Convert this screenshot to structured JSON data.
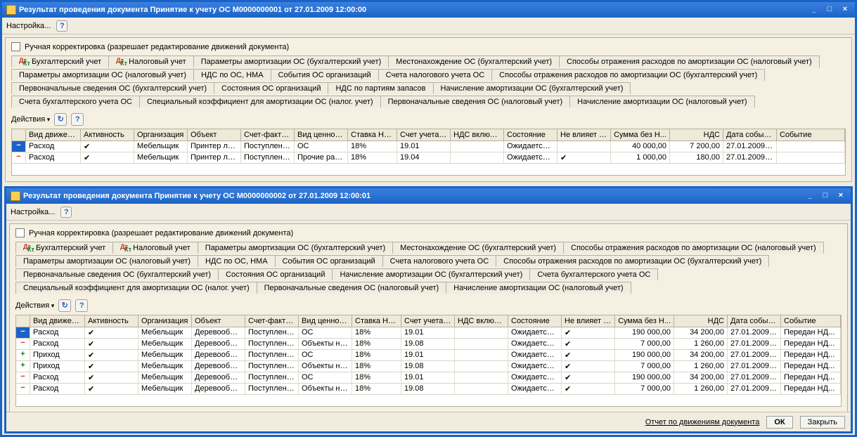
{
  "win1": {
    "title": "Результат проведения документа Принятие к учету ОС М0000000001 от 27.01.2009 12:00:00",
    "settings": "Настройка...",
    "manual_edit": "Ручная корректировка (разрешает редактирование движений документа)",
    "tabs_r1": [
      "Бухгалтерский учет",
      "Налоговый учет",
      "Параметры амортизации ОС (бухгалтерский учет)",
      "Местонахождение ОС (бухгалтерский учет)",
      "Способы отражения расходов по амортизации ОС (налоговый учет)"
    ],
    "tabs_r2": [
      "Параметры амортизации ОС (налоговый учет)",
      "НДС по ОС, НМА",
      "События ОС организаций",
      "Счета налогового учета ОС",
      "Способы отражения расходов по амортизации ОС (бухгалтерский учет)"
    ],
    "tabs_r3": [
      "Первоначальные сведения ОС (бухгалтерский учет)",
      "Состояния ОС организаций",
      "НДС по партиям запасов",
      "Начисление амортизации ОС (бухгалтерский учет)"
    ],
    "tabs_r4": [
      "Счета бухгалтерского учета ОС",
      "Специальный коэффициент для амортизации ОС (налог. учет)",
      "Первоначальные сведения ОС (налоговый учет)",
      "Начисление амортизации ОС (налоговый учет)"
    ],
    "actions": "Действия",
    "cols": [
      "",
      "Вид движения",
      "Активность",
      "Организация",
      "Объект",
      "Счет-фактура",
      "Вид ценности",
      "Ставка НДС",
      "Счет учета Н...",
      "НДС включе...",
      "Состояние",
      "Не влияет н...",
      "Сумма без Н...",
      "НДС",
      "Дата события",
      "Событие"
    ],
    "rows": [
      {
        "sign": "−",
        "move": "Расход",
        "act": "✔",
        "org": "Мебельщик",
        "obj": "Принтер лаз...",
        "inv": "Поступлени...",
        "val": "ОС",
        "vat": "18%",
        "acc": "19.01",
        "vinc": "",
        "state": "Ожидается ...",
        "noaff": "",
        "sum": "40 000,00",
        "nds": "7 200,00",
        "date": "27.01.2009 1...",
        "evt": ""
      },
      {
        "sign": "−",
        "move": "Расход",
        "act": "✔",
        "org": "Мебельщик",
        "obj": "Принтер лаз...",
        "inv": "Поступлени...",
        "val": "Прочие рабо...",
        "vat": "18%",
        "acc": "19.04",
        "vinc": "",
        "state": "Ожидается ...",
        "noaff": "✔",
        "sum": "1 000,00",
        "nds": "180,00",
        "date": "27.01.2009 1...",
        "evt": ""
      }
    ]
  },
  "win2": {
    "title": "Результат проведения документа Принятие к учету ОС М0000000002 от 27.01.2009 12:00:01",
    "settings": "Настройка...",
    "manual_edit": "Ручная корректировка (разрешает редактирование движений документа)",
    "tabs_r1": [
      "Бухгалтерский учет",
      "Налоговый учет",
      "Параметры амортизации ОС (бухгалтерский учет)",
      "Местонахождение ОС (бухгалтерский учет)",
      "Способы отражения расходов по амортизации ОС (налоговый учет)"
    ],
    "tabs_r2": [
      "Параметры амортизации ОС (налоговый учет)",
      "НДС по ОС, НМА",
      "События ОС организаций",
      "Счета налогового учета ОС",
      "Способы отражения расходов по амортизации ОС (бухгалтерский учет)"
    ],
    "tabs_r3": [
      "Первоначальные сведения ОС (бухгалтерский учет)",
      "Состояния ОС организаций",
      "Начисление амортизации ОС (бухгалтерский учет)",
      "Счета бухгалтерского учета ОС"
    ],
    "tabs_r4": [
      "Специальный коэффициент для амортизации ОС (налог. учет)",
      "Первоначальные сведения ОС (налоговый учет)",
      "Начисление амортизации ОС (налоговый учет)"
    ],
    "actions": "Действия",
    "cols": [
      "",
      "Вид движения",
      "Активность",
      "Организация",
      "Объект",
      "Счет-фактура",
      "Вид ценности",
      "Ставка НДС",
      "Счет учета Н...",
      "НДС включе...",
      "Состояние",
      "Не влияет н...",
      "Сумма без Н...",
      "НДС",
      "Дата события",
      "Событие"
    ],
    "rows": [
      {
        "sign": "−",
        "move": "Расход",
        "act": "✔",
        "org": "Мебельщик",
        "obj": "Деревообра...",
        "inv": "Поступлени...",
        "val": "ОС",
        "vat": "18%",
        "acc": "19.01",
        "vinc": "",
        "state": "Ожидается ...",
        "noaff": "✔",
        "sum": "190 000,00",
        "nds": "34 200,00",
        "date": "27.01.2009 1...",
        "evt": "Передан НД..."
      },
      {
        "sign": "−",
        "move": "Расход",
        "act": "✔",
        "org": "Мебельщик",
        "obj": "Деревообра...",
        "inv": "Поступлени...",
        "val": "Объекты не...",
        "vat": "18%",
        "acc": "19.08",
        "vinc": "",
        "state": "Ожидается ...",
        "noaff": "✔",
        "sum": "7 000,00",
        "nds": "1 260,00",
        "date": "27.01.2009 1...",
        "evt": "Передан НД..."
      },
      {
        "sign": "+",
        "move": "Приход",
        "act": "✔",
        "org": "Мебельщик",
        "obj": "Деревообра...",
        "inv": "Поступлени...",
        "val": "ОС",
        "vat": "18%",
        "acc": "19.01",
        "vinc": "",
        "state": "Ожидается ...",
        "noaff": "✔",
        "sum": "190 000,00",
        "nds": "34 200,00",
        "date": "27.01.2009 1...",
        "evt": "Передан НД..."
      },
      {
        "sign": "+",
        "move": "Приход",
        "act": "✔",
        "org": "Мебельщик",
        "obj": "Деревообра...",
        "inv": "Поступлени...",
        "val": "Объекты не...",
        "vat": "18%",
        "acc": "19.08",
        "vinc": "",
        "state": "Ожидается ...",
        "noaff": "✔",
        "sum": "7 000,00",
        "nds": "1 260,00",
        "date": "27.01.2009 1...",
        "evt": "Передан НД..."
      },
      {
        "sign": "−",
        "move": "Расход",
        "act": "✔",
        "org": "Мебельщик",
        "obj": "Деревообра...",
        "inv": "Поступлени...",
        "val": "ОС",
        "vat": "18%",
        "acc": "19.01",
        "vinc": "",
        "state": "Ожидается ...",
        "noaff": "✔",
        "sum": "190 000,00",
        "nds": "34 200,00",
        "date": "27.01.2009 1...",
        "evt": "Передан НД..."
      },
      {
        "sign": "−",
        "move": "Расход",
        "act": "✔",
        "org": "Мебельщик",
        "obj": "Деревообра...",
        "inv": "Поступлени...",
        "val": "Объекты не...",
        "vat": "18%",
        "acc": "19.08",
        "vinc": "",
        "state": "Ожидается ...",
        "noaff": "✔",
        "sum": "7 000,00",
        "nds": "1 260,00",
        "date": "27.01.2009 1...",
        "evt": "Передан НД..."
      }
    ],
    "footer_report": "Отчет по движениям документа",
    "footer_ok": "ОК",
    "footer_close": "Закрыть"
  }
}
